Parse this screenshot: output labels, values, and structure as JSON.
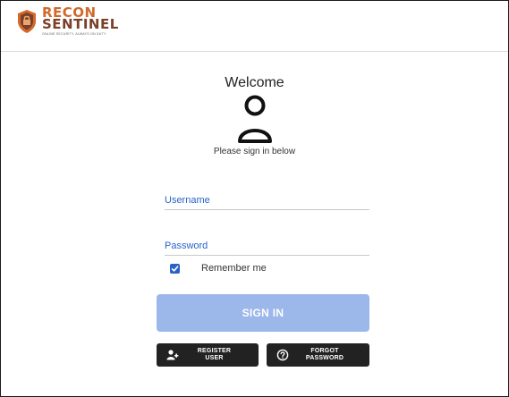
{
  "brand": {
    "line1": "RECON",
    "line2": "SENTINEL",
    "tagline": "ONLINE SECURITY, ALWAYS ON DUTY"
  },
  "login": {
    "title": "Welcome",
    "subtitle": "Please sign in below",
    "username_placeholder": "Username",
    "password_placeholder": "Password",
    "remember_label": "Remember me",
    "remember_checked": true,
    "signin_label": "SIGN IN",
    "register_line1": "REGISTER",
    "register_line2": "USER",
    "forgot_line1": "FORGOT",
    "forgot_line2": "PASSWORD"
  },
  "icons": {
    "brand": "shield-logo-icon",
    "avatar": "user-avatar-icon",
    "checkbox": "check-icon",
    "register": "add-user-icon",
    "forgot": "help-circle-icon"
  },
  "colors": {
    "accent": "#2a63c8",
    "signin_bg": "#9cb7ea",
    "dark_button": "#222222",
    "brand_orange": "#d2692b"
  }
}
